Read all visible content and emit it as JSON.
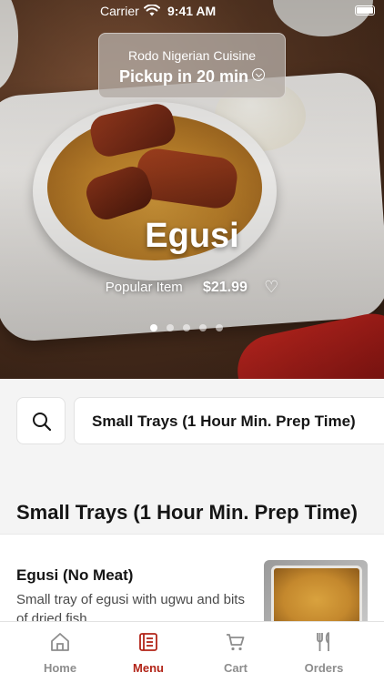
{
  "status_bar": {
    "carrier": "Carrier",
    "time": "9:41 AM"
  },
  "location": {
    "restaurant": "Rodo Nigerian Cuisine",
    "pickup": "Pickup in 20 min"
  },
  "featured": {
    "title": "Egusi",
    "tag": "Popular Item",
    "price": "$21.99",
    "carousel_index": 1,
    "carousel_count": 5
  },
  "category_bar": {
    "selected_category": "Small Trays (1 Hour Min. Prep Time)"
  },
  "section": {
    "title": "Small Trays (1 Hour Min. Prep Time)"
  },
  "items": [
    {
      "name": "Egusi (No Meat)",
      "description": "Small tray of egusi with ugwu and bits of dried fish."
    }
  ],
  "tabs": [
    {
      "label": "Home",
      "icon": "home-icon",
      "active": false
    },
    {
      "label": "Menu",
      "icon": "menu-icon",
      "active": true
    },
    {
      "label": "Cart",
      "icon": "cart-icon",
      "active": false
    },
    {
      "label": "Orders",
      "icon": "fork-knife-icon",
      "active": false
    }
  ],
  "colors": {
    "accent": "#b22418",
    "inactive_tab": "#8d8d8d",
    "background": "#f4f4f4"
  }
}
